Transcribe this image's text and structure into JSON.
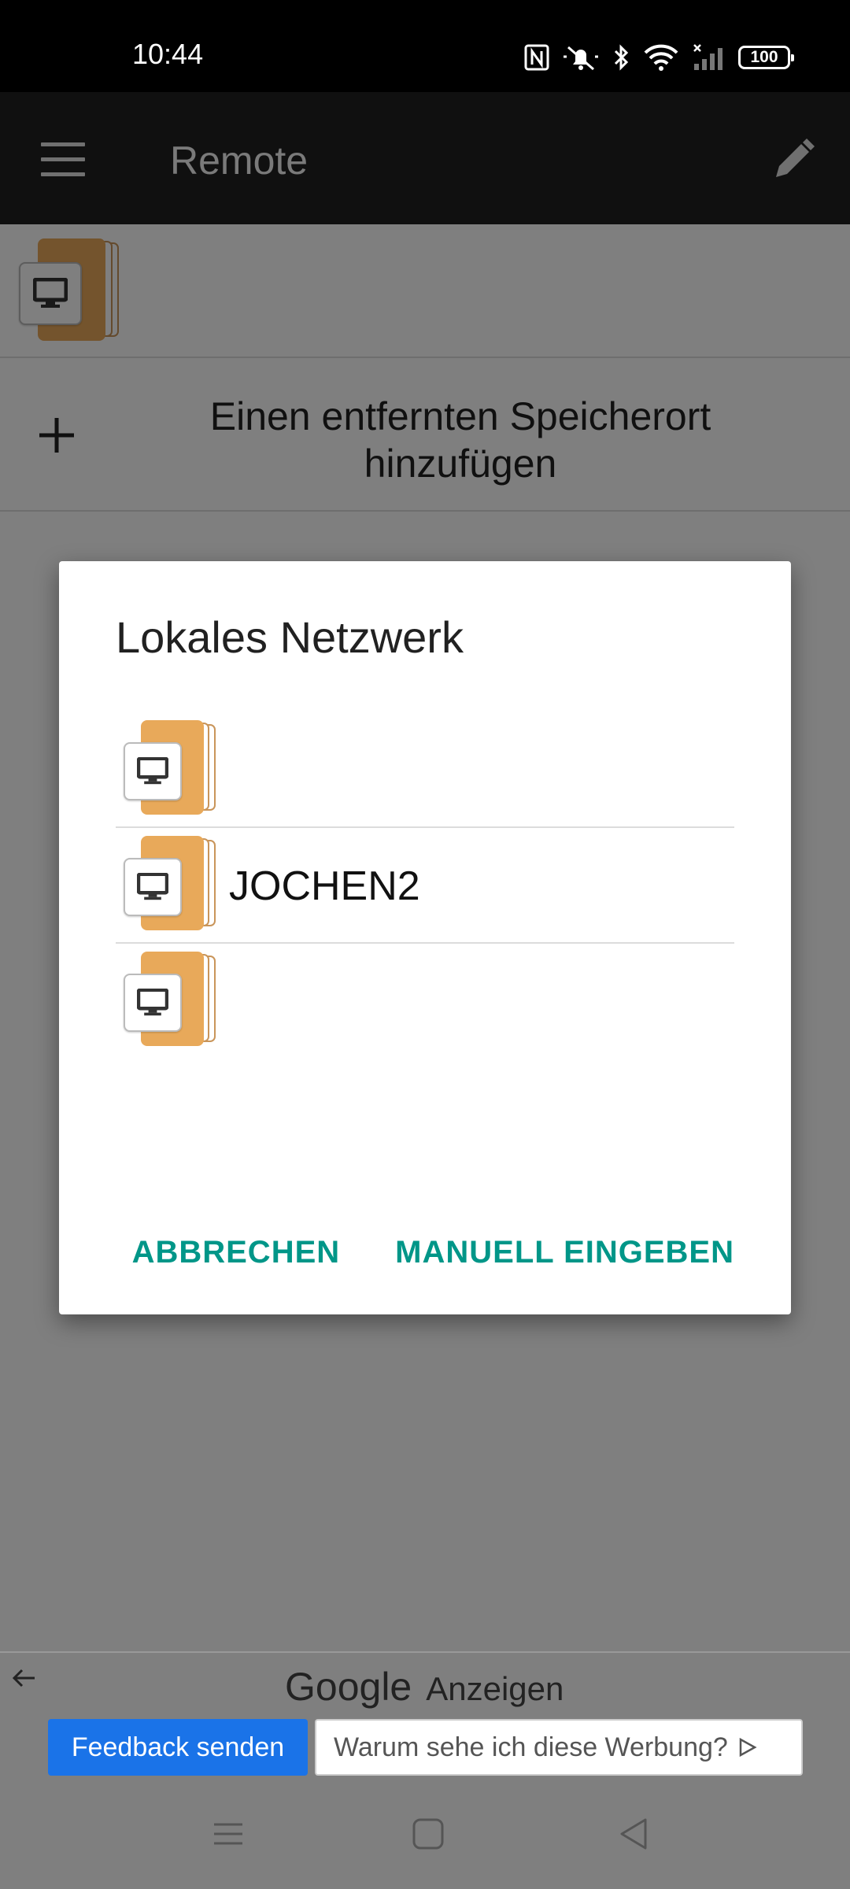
{
  "status_bar": {
    "time": "10:44",
    "battery": "100"
  },
  "app_bar": {
    "title": "Remote"
  },
  "content": {
    "add_location_label": "Einen entfernten Speicherort hinzufügen"
  },
  "dialog": {
    "title": "Lokales Netzwerk",
    "items": [
      {
        "label": ""
      },
      {
        "label": "JOCHEN2"
      },
      {
        "label": ""
      }
    ],
    "cancel_label": "ABBRECHEN",
    "manual_label": "MANUELL EINGEBEN"
  },
  "ad": {
    "brand": "Google",
    "label": "Anzeigen",
    "feedback_label": "Feedback senden",
    "why_label": "Warum sehe ich diese Werbung?"
  },
  "colors": {
    "accent": "#009688",
    "folder": "#e8a95a",
    "app_bar": "#212121",
    "feedback": "#1a73e8"
  }
}
